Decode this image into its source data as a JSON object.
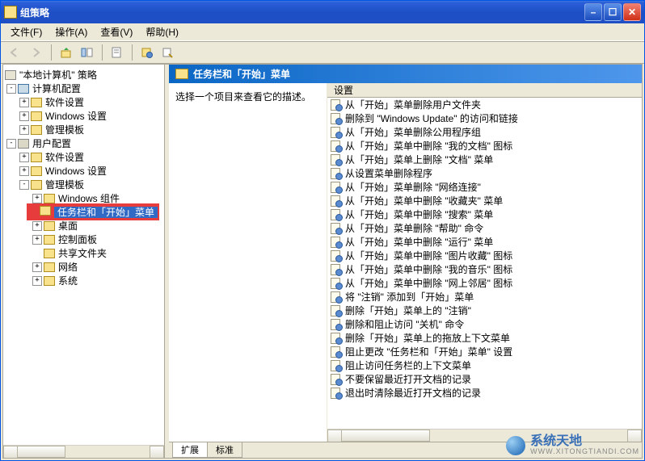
{
  "window": {
    "title": "组策略"
  },
  "menu": {
    "file": "文件(F)",
    "action": "操作(A)",
    "view": "查看(V)",
    "help": "帮助(H)"
  },
  "tree": {
    "root": "\"本地计算机\" 策略",
    "computer": "计算机配置",
    "comp_software": "软件设置",
    "comp_windows": "Windows 设置",
    "comp_admin": "管理模板",
    "user": "用户配置",
    "user_software": "软件设置",
    "user_windows": "Windows 设置",
    "user_admin": "管理模板",
    "admin_wincomp": "Windows 组件",
    "admin_taskbar": "任务栏和「开始」菜单",
    "admin_desktop": "桌面",
    "admin_control": "控制面板",
    "admin_shared": "共享文件夹",
    "admin_network": "网络",
    "admin_system": "系统"
  },
  "right": {
    "header": "任务栏和「开始」菜单",
    "desc": "选择一个项目来查看它的描述。",
    "col_setting": "设置",
    "tab_ext": "扩展",
    "tab_std": "标准"
  },
  "settings": [
    "从「开始」菜单删除用户文件夹",
    "删除到 \"Windows Update\" 的访问和链接",
    "从「开始」菜单删除公用程序组",
    "从「开始」菜单中删除 \"我的文档\" 图标",
    "从「开始」菜单上删除 \"文档\" 菜单",
    "从设置菜单删除程序",
    "从「开始」菜单删除 \"网络连接\"",
    "从「开始」菜单中删除 \"收藏夹\" 菜单",
    "从「开始」菜单中删除 \"搜索\" 菜单",
    "从「开始」菜单删除 \"帮助\" 命令",
    "从「开始」菜单中删除 \"运行\" 菜单",
    "从「开始」菜单中删除 \"图片收藏\" 图标",
    "从「开始」菜单中删除 \"我的音乐\" 图标",
    "从「开始」菜单中删除 \"网上邻居\" 图标",
    "将 \"注销\" 添加到「开始」菜单",
    "删除「开始」菜单上的 \"注销\"",
    "删除和阻止访问 \"关机\" 命令",
    "删除「开始」菜单上的拖放上下文菜单",
    "阻止更改 \"任务栏和「开始」菜单\" 设置",
    "阻止访问任务栏的上下文菜单",
    "不要保留最近打开文档的记录",
    "退出时清除最近打开文档的记录"
  ],
  "watermark": {
    "brand": "系统天地",
    "sub": "WWW.XITONGTIANDI.COM"
  }
}
